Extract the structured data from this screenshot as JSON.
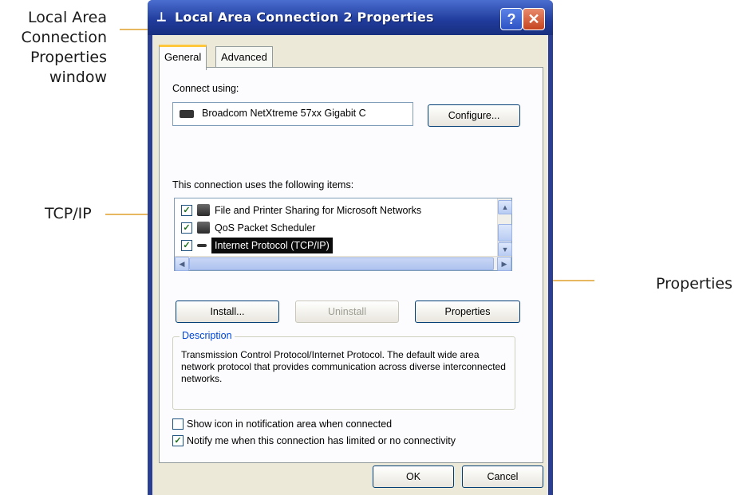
{
  "callouts": {
    "window_label": "Local Area\nConnection\nProperties\nwindow",
    "tcpip_label": "TCP/IP",
    "properties_label": "Properties"
  },
  "window": {
    "title": "Local Area Connection 2 Properties",
    "help_glyph": "?",
    "close_glyph": "✕"
  },
  "tabs": [
    {
      "label": "General",
      "active": true
    },
    {
      "label": "Advanced",
      "active": false
    }
  ],
  "connect_using": {
    "label": "Connect using:",
    "adapter": "Broadcom NetXtreme 57xx Gigabit C",
    "configure_button": "Configure..."
  },
  "items": {
    "heading": "This connection uses the following items:",
    "list": [
      {
        "label": "File and Printer Sharing for Microsoft Networks",
        "checked": true,
        "selected": false
      },
      {
        "label": "QoS Packet Scheduler",
        "checked": true,
        "selected": false
      },
      {
        "label": "Internet Protocol (TCP/IP)",
        "checked": true,
        "selected": true
      }
    ]
  },
  "buttons": {
    "install": "Install...",
    "uninstall": "Uninstall",
    "properties": "Properties",
    "ok": "OK",
    "cancel": "Cancel"
  },
  "description": {
    "legend": "Description",
    "text": "Transmission Control Protocol/Internet Protocol. The default wide area network protocol that provides communication across diverse interconnected networks."
  },
  "options": [
    {
      "label": "Show icon in notification area when connected",
      "checked": false
    },
    {
      "label": "Notify me when this connection has limited or no connectivity",
      "checked": true
    }
  ],
  "colors": {
    "leader_line": "#e8b860",
    "titlebar": "#1f3a9a",
    "selection": "#0b0b0b"
  }
}
